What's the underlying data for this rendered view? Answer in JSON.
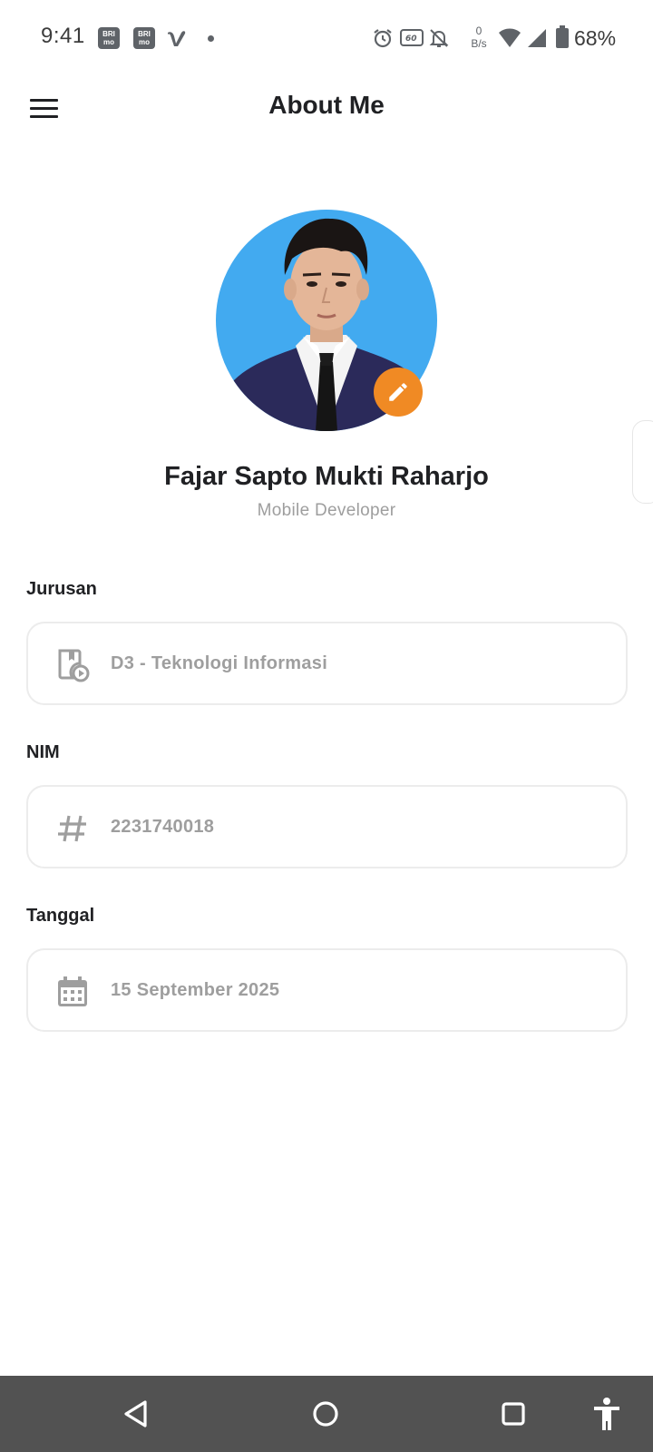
{
  "status_bar": {
    "time": "9:41",
    "notification_icons": [
      "brimo-icon",
      "brimo-icon",
      "vidio-icon",
      "dot-icon"
    ],
    "system_icons": [
      "alarm-icon",
      "refresh-60hz-icon",
      "notifications-off-icon",
      "wifi-icon",
      "cell-signal-icon",
      "battery-icon"
    ],
    "brimo_text": "BRI mo",
    "net_speed_value": "0",
    "net_speed_unit": "B/s",
    "battery_percent": "68%"
  },
  "app_bar": {
    "title": "About Me",
    "menu_icon": "hamburger-menu-icon"
  },
  "profile": {
    "name": "Fajar Sapto Mukti Raharjo",
    "role": "Mobile Developer",
    "avatar_description_icon": "profile-photo",
    "edit_icon": "pencil-icon"
  },
  "fields": [
    {
      "label": "Jurusan",
      "value": "D3 - Teknologi Informasi",
      "icon": "video-library-icon"
    },
    {
      "label": "NIM",
      "value": "2231740018",
      "icon": "hash-icon"
    },
    {
      "label": "Tanggal",
      "value": "15 September 2025",
      "icon": "calendar-icon"
    }
  ],
  "nav_bar": {
    "buttons": [
      "back-icon",
      "home-icon",
      "recents-icon",
      "accessibility-icon"
    ]
  },
  "colors": {
    "accent": "#f08a24",
    "avatar_background": "#42aaf0",
    "text_primary": "#202124",
    "text_secondary": "#9e9e9e",
    "field_border": "#ececec",
    "nav_bar": "#525252"
  }
}
